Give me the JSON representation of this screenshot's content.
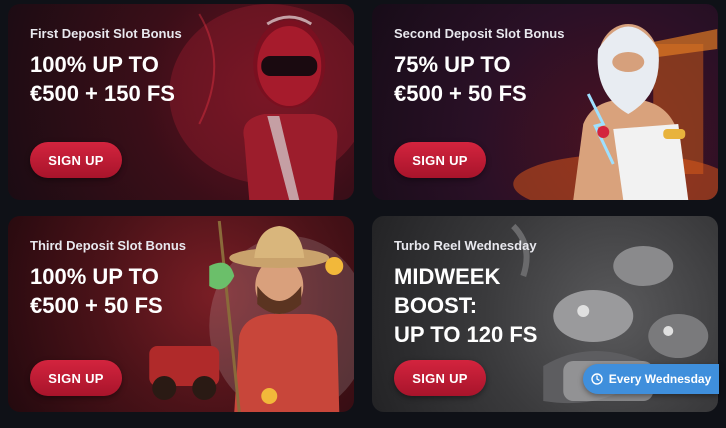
{
  "promos": [
    {
      "subtitle": "First Deposit Slot Bonus",
      "headline": [
        "100% UP TO",
        "€500 + 150 FS"
      ],
      "cta": "SIGN UP",
      "art": "racing-driver-illustration"
    },
    {
      "subtitle": "Second Deposit Slot Bonus",
      "headline": [
        "75% UP TO",
        "€500 + 50 FS"
      ],
      "cta": "SIGN UP",
      "art": "zeus-illustration"
    },
    {
      "subtitle": "Third Deposit Slot Bonus",
      "headline": [
        "100% UP TO",
        "€500 + 50 FS"
      ],
      "cta": "SIGN UP",
      "art": "cowboy-fisherman-illustration"
    },
    {
      "subtitle": "Turbo Reel Wednesday",
      "headline": [
        "MIDWEEK",
        "BOOST:",
        "UP TO 120 FS"
      ],
      "cta": "SIGN UP",
      "art": "fishin-reels-illustration"
    }
  ],
  "schedule_badge": {
    "label": "Every Wednesday",
    "icon": "clock-icon",
    "color": "#3f8fdc"
  },
  "colors": {
    "background": "#0f1117",
    "cta": "#c81d36"
  }
}
